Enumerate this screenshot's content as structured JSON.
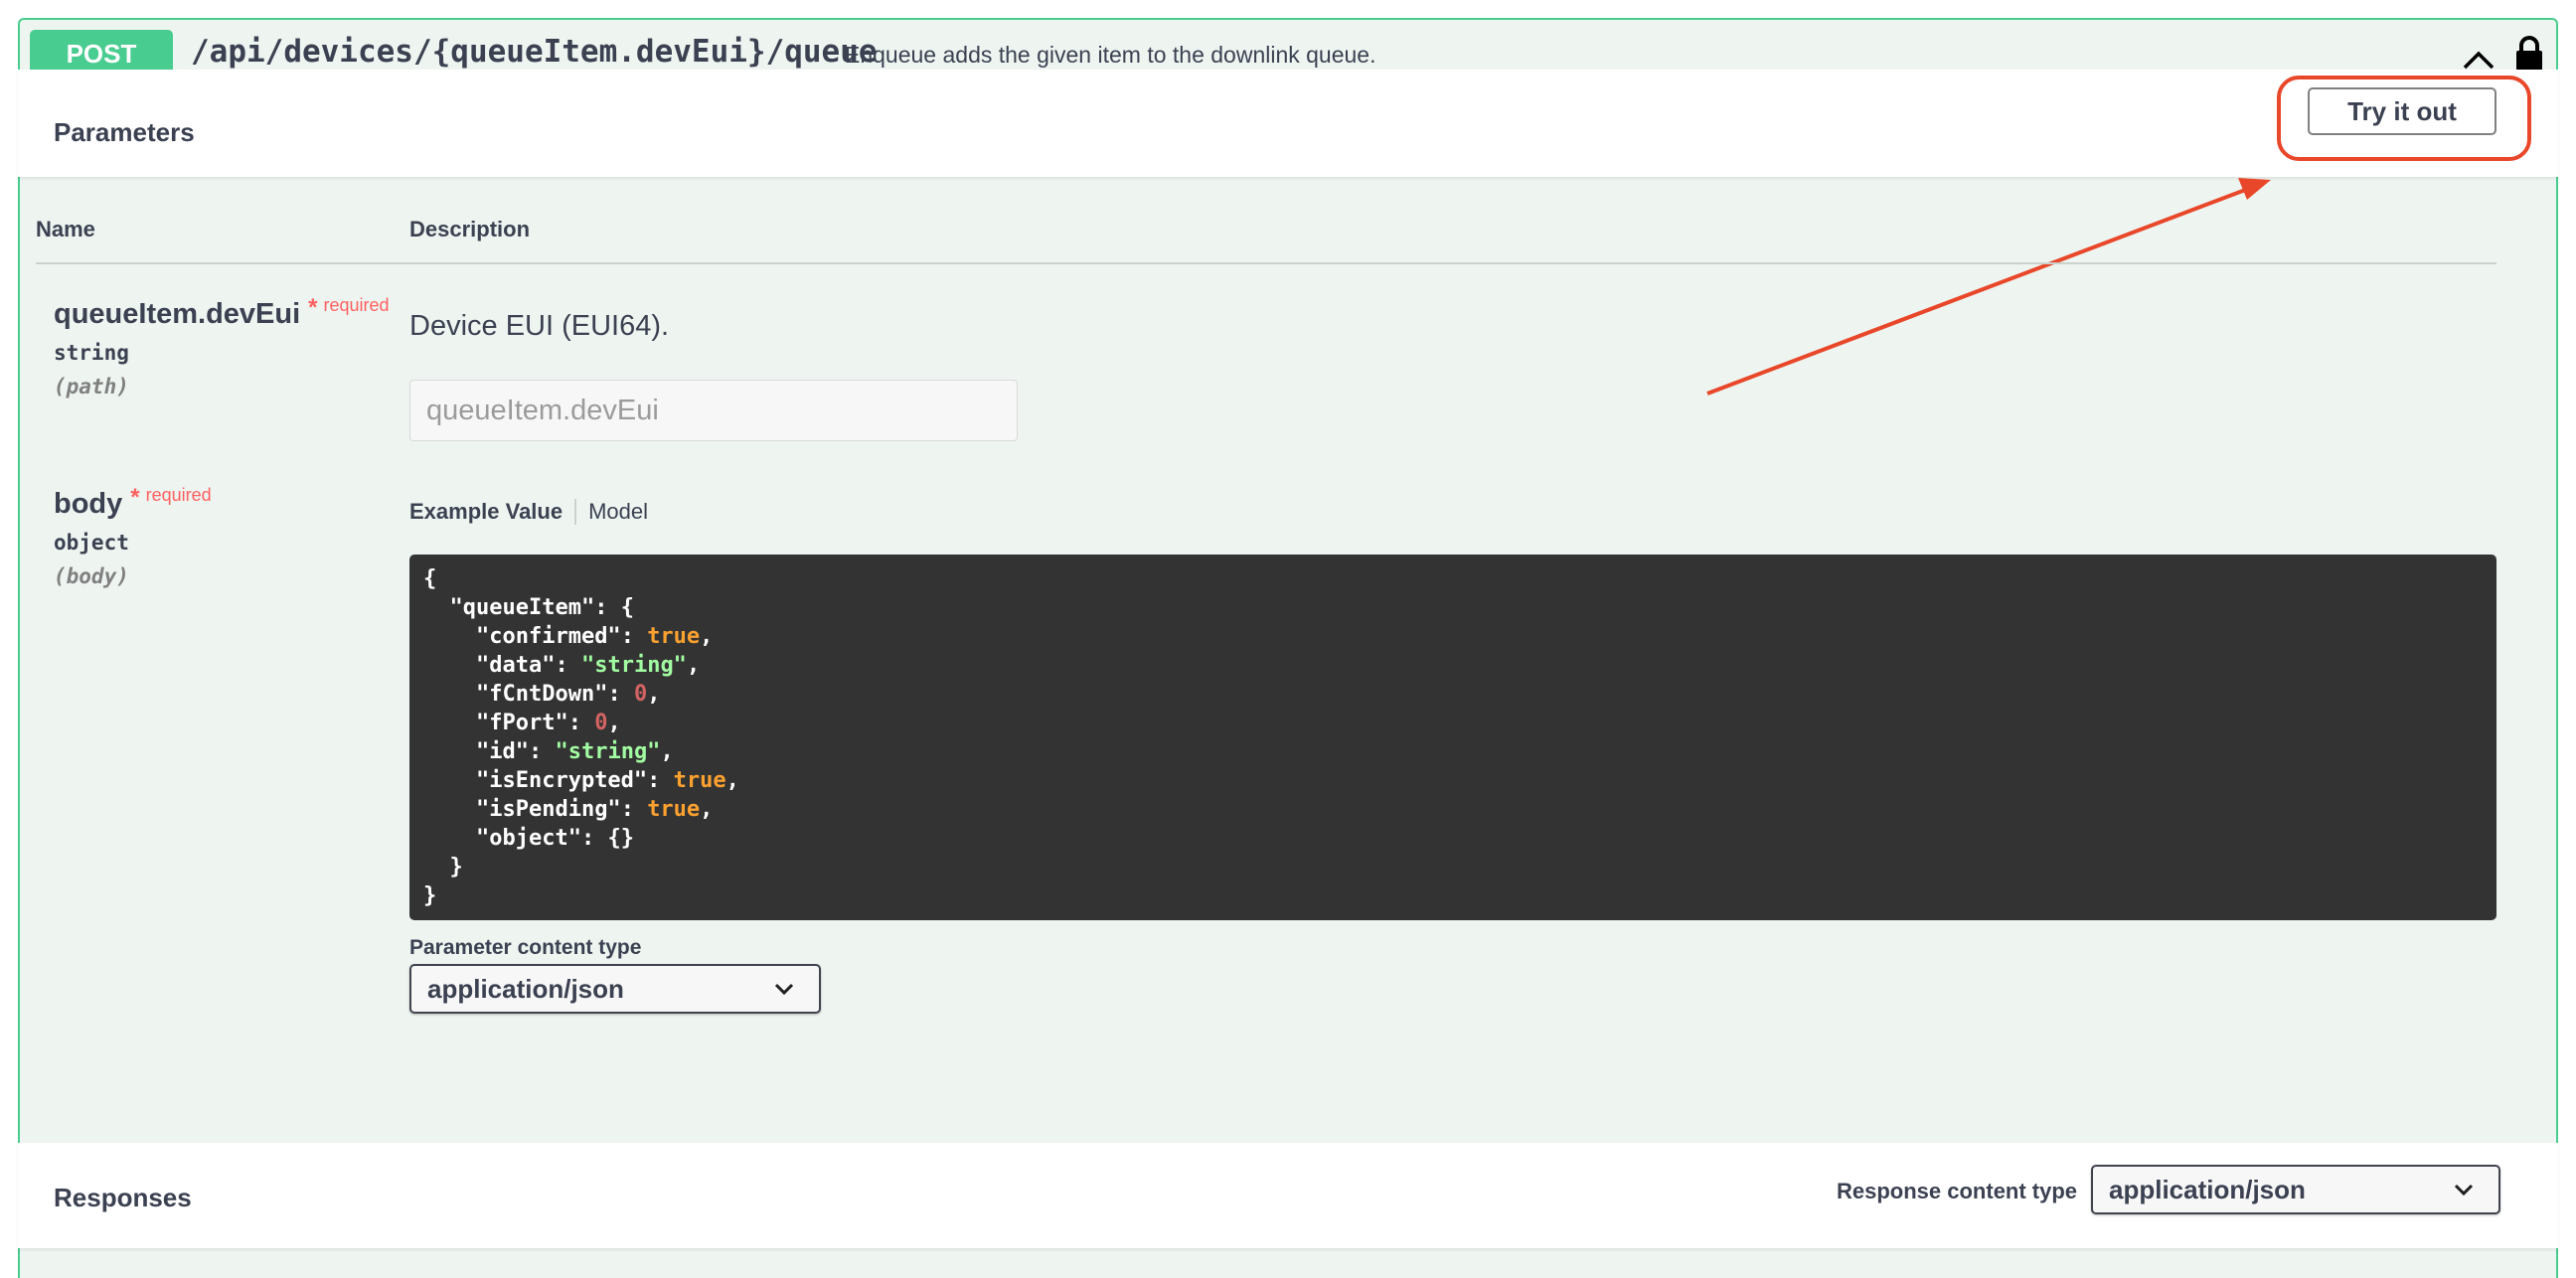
{
  "operation": {
    "method": "POST",
    "path": "/api/devices/{queueItem.devEui}/queue",
    "summary": "Enqueue adds the given item to the downlink queue."
  },
  "parameters_section": {
    "title": "Parameters",
    "try_it_out_label": "Try it out",
    "col_name": "Name",
    "col_description": "Description"
  },
  "params": [
    {
      "name": "queueItem.devEui",
      "required_star": "*",
      "required_label": "required",
      "type": "string",
      "in": "(path)",
      "description": "Device EUI (EUI64).",
      "placeholder": "queueItem.devEui",
      "value": ""
    },
    {
      "name": "body",
      "required_star": "*",
      "required_label": "required",
      "type": "object",
      "in": "(body)"
    }
  ],
  "body_tabs": {
    "example_value": "Example Value",
    "model": "Model"
  },
  "example_json": {
    "l0": "{",
    "l1_key": "\"queueItem\"",
    "l1_rest": ": {",
    "l2_key": "\"confirmed\"",
    "l2_val": "true",
    "l3_key": "\"data\"",
    "l3_val": "\"string\"",
    "l4_key": "\"fCntDown\"",
    "l4_val": "0",
    "l5_key": "\"fPort\"",
    "l5_val": "0",
    "l6_key": "\"id\"",
    "l6_val": "\"string\"",
    "l7_key": "\"isEncrypted\"",
    "l7_val": "true",
    "l8_key": "\"isPending\"",
    "l8_val": "true",
    "l9_key": "\"object\"",
    "l9_val": "{}",
    "l10": "}",
    "l11": "}"
  },
  "parameter_content_type": {
    "label": "Parameter content type",
    "selected": "application/json"
  },
  "responses_section": {
    "title": "Responses",
    "content_type_label": "Response content type",
    "selected": "application/json"
  },
  "icons": {
    "collapse": "chevron-up-icon",
    "auth": "lock-icon",
    "dropdown": "chevron-down-icon"
  },
  "colors": {
    "post_green": "#49cc90",
    "annotation_red": "#e9472a",
    "code_bg": "#333333"
  }
}
